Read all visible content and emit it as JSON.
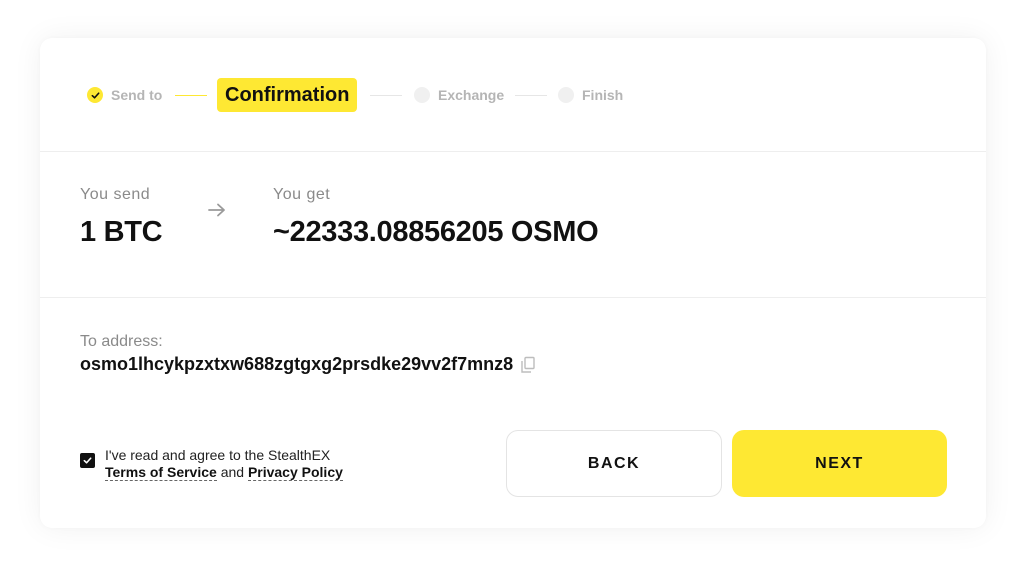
{
  "stepper": {
    "steps": [
      {
        "label": "Send to",
        "state": "done"
      },
      {
        "label": "Confirmation",
        "state": "active"
      },
      {
        "label": "Exchange",
        "state": "pending"
      },
      {
        "label": "Finish",
        "state": "pending"
      }
    ]
  },
  "exchange": {
    "send_label": "You send",
    "send_value": "1 BTC",
    "get_label": "You get",
    "get_value": "~22333.08856205 OSMO"
  },
  "address": {
    "label": "To address:",
    "value": "osmo1lhcykpzxtxw688zgtgxg2prsdke29vv2f7mnz8"
  },
  "agreement": {
    "checked": true,
    "text_prefix": "I've read and agree to the StealthEX",
    "terms_link": "Terms of Service",
    "conjunction": "and",
    "privacy_link": "Privacy Policy"
  },
  "buttons": {
    "back_label": "BACK",
    "next_label": "NEXT"
  },
  "colors": {
    "accent": "#fee833",
    "muted_text": "#8a8a8a",
    "step_inactive": "#b5b5b5"
  }
}
